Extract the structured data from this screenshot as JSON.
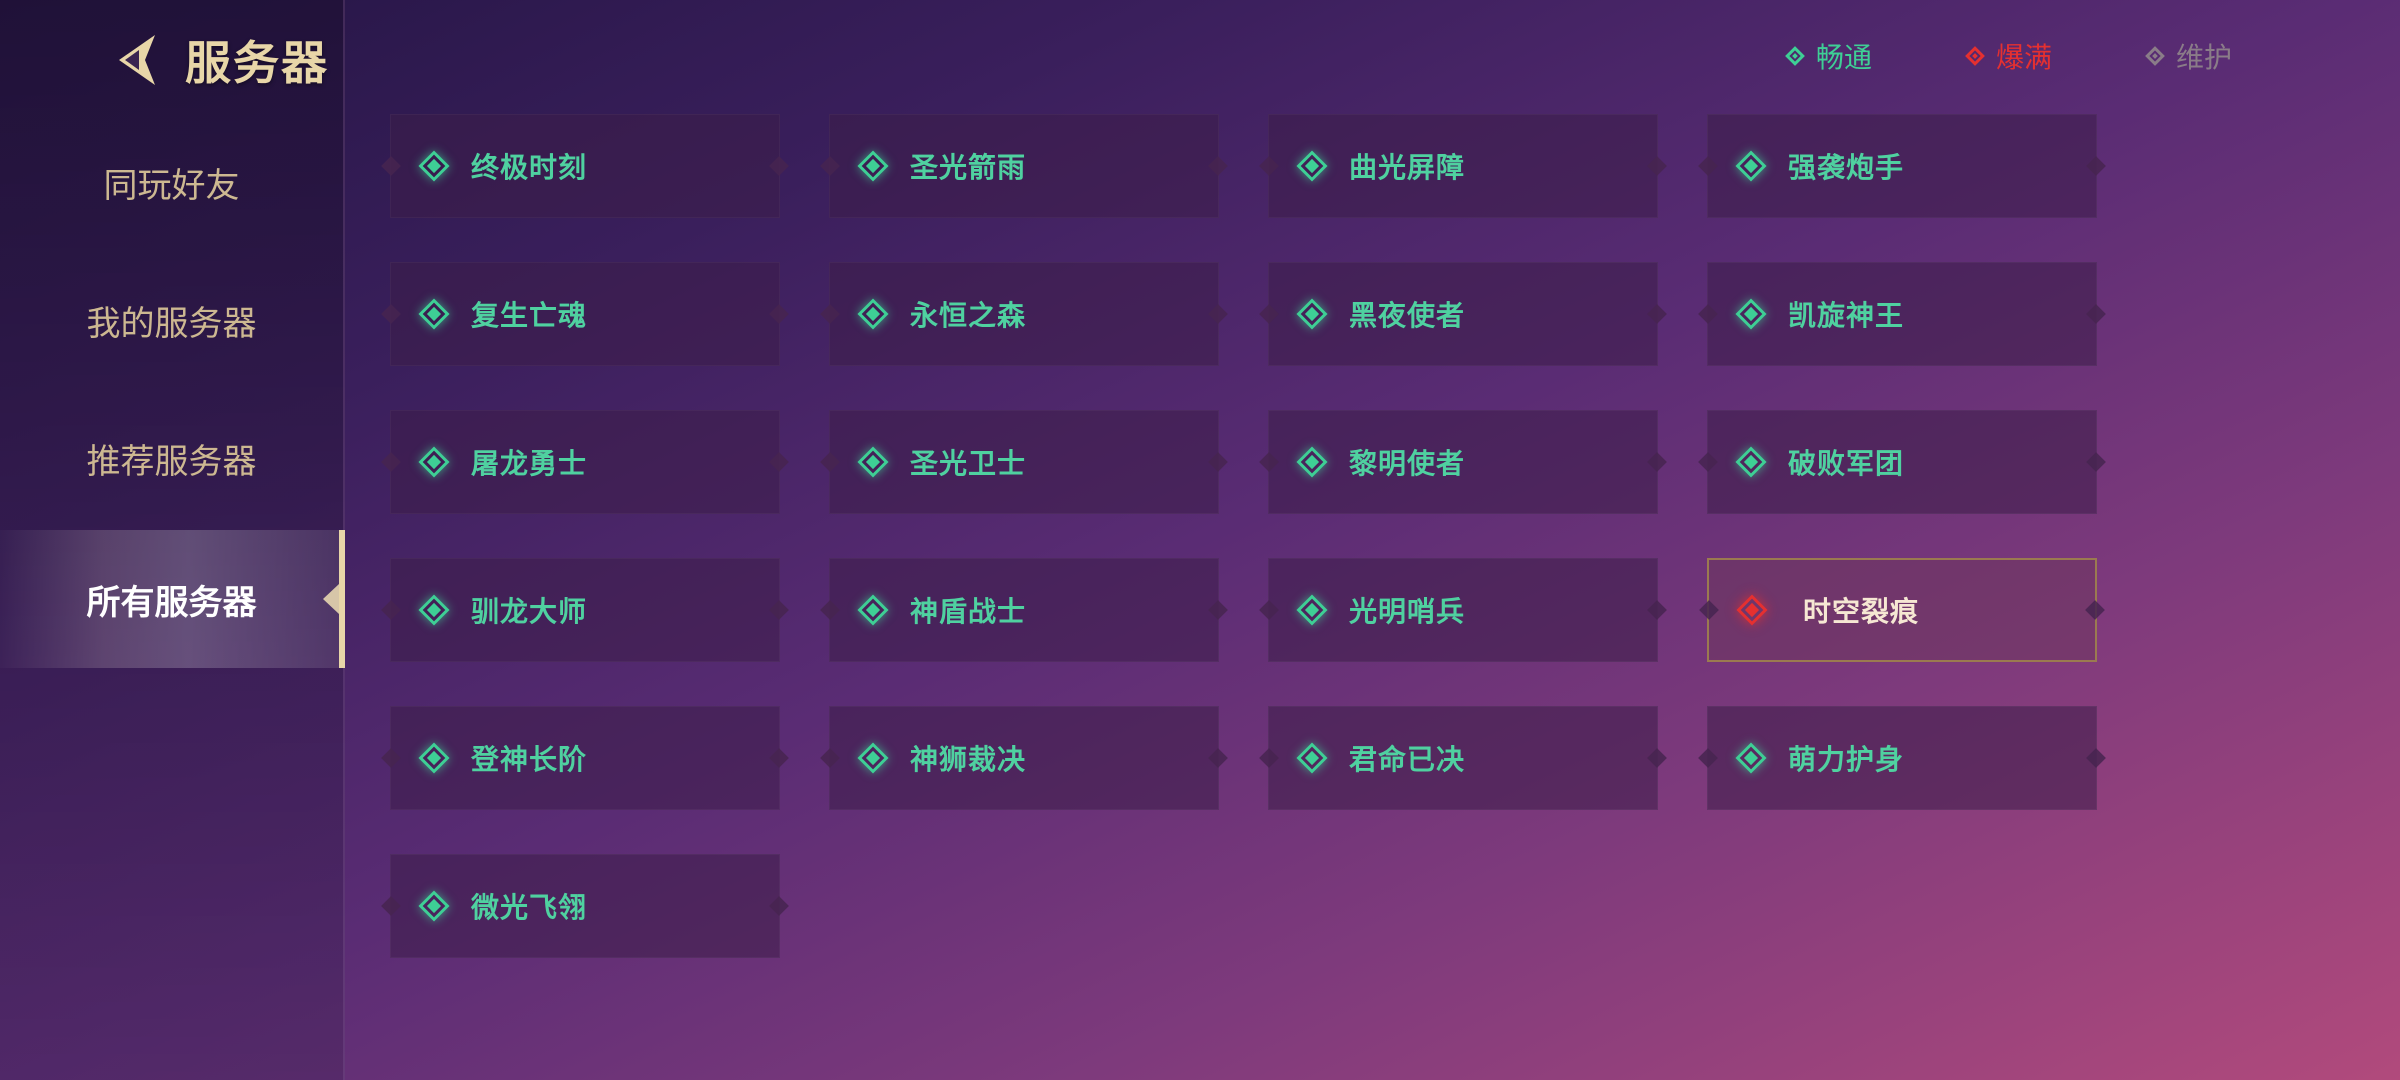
{
  "header": {
    "title": "服务器",
    "back_icon": "back-arrow-icon"
  },
  "sidebar": {
    "items": [
      {
        "label": "同玩好友",
        "active": false
      },
      {
        "label": "我的服务器",
        "active": false
      },
      {
        "label": "推荐服务器",
        "active": false
      },
      {
        "label": "所有服务器",
        "active": true
      }
    ]
  },
  "legend": [
    {
      "label": "畅通",
      "color": "#3ecf95"
    },
    {
      "label": "爆满",
      "color": "#e53030"
    },
    {
      "label": "维护",
      "color": "#8a7c88"
    }
  ],
  "servers": [
    {
      "name": "终极时刻",
      "status": "畅通"
    },
    {
      "name": "圣光箭雨",
      "status": "畅通"
    },
    {
      "name": "曲光屏障",
      "status": "畅通"
    },
    {
      "name": "强袭炮手",
      "status": "畅通"
    },
    {
      "name": "复生亡魂",
      "status": "畅通"
    },
    {
      "name": "永恒之森",
      "status": "畅通"
    },
    {
      "name": "黑夜使者",
      "status": "畅通"
    },
    {
      "name": "凯旋神王",
      "status": "畅通"
    },
    {
      "name": "屠龙勇士",
      "status": "畅通"
    },
    {
      "name": "圣光卫士",
      "status": "畅通"
    },
    {
      "name": "黎明使者",
      "status": "畅通"
    },
    {
      "name": "破败军团",
      "status": "畅通"
    },
    {
      "name": "驯龙大师",
      "status": "畅通"
    },
    {
      "name": "神盾战士",
      "status": "畅通"
    },
    {
      "name": "光明哨兵",
      "status": "畅通"
    },
    {
      "name": "时空裂痕",
      "status": "爆满",
      "selected": true
    },
    {
      "name": "登神长阶",
      "status": "畅通"
    },
    {
      "name": "神狮裁决",
      "status": "畅通"
    },
    {
      "name": "君命已决",
      "status": "畅通"
    },
    {
      "name": "萌力护身",
      "status": "畅通"
    },
    {
      "name": "微光飞翎",
      "status": "畅通"
    }
  ]
}
